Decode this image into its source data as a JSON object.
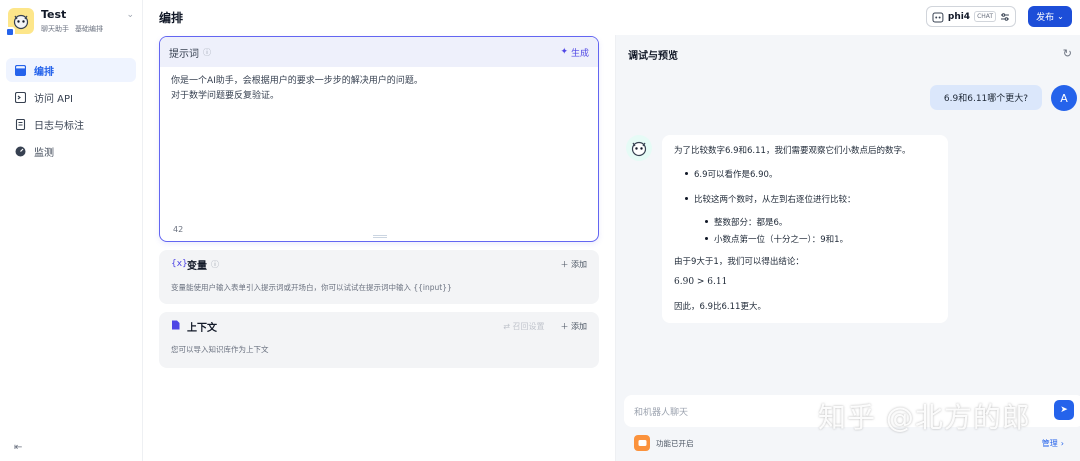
{
  "app": {
    "name": "Test",
    "tags": [
      "聊天助手",
      "基础编排"
    ]
  },
  "sidebar": {
    "items": [
      {
        "label": "编排",
        "icon": "layout-icon",
        "active": true
      },
      {
        "label": "访问 API",
        "icon": "terminal-icon",
        "active": false
      },
      {
        "label": "日志与标注",
        "icon": "document-icon",
        "active": false
      },
      {
        "label": "监测",
        "icon": "gauge-icon",
        "active": false
      }
    ]
  },
  "header": {
    "title": "编排",
    "model": {
      "name": "phi4",
      "mode": "CHAT"
    },
    "publish_label": "发布"
  },
  "prompt": {
    "title": "提示词",
    "generate_label": "生成",
    "lines": [
      "你是一个AI助手，会根据用户的要求一步步的解决用户的问题。",
      "对于数学问题要反复验证。"
    ],
    "count": "42"
  },
  "variables": {
    "title": "变量",
    "add_label": "添加",
    "description": "变量能使用户输入表单引入提示词或开场白，你可以试试在提示词中输入 {{input}}"
  },
  "context": {
    "title": "上下文",
    "recall_label": "召回设置",
    "add_label": "添加",
    "description": "您可以导入知识库作为上下文"
  },
  "debug": {
    "title": "调试与预览",
    "user_message": "6.9和6.11哪个更大?",
    "user_avatar": "A",
    "bot_reply": {
      "intro": "为了比较数字6.9和6.11，我们需要观察它们小数点后的数字。",
      "b1": "6.9可以看作是6.90。",
      "b2": "比较这两个数时，从左到右逐位进行比较：",
      "b2a": "整数部分：都是6。",
      "b2b": "小数点第一位（十分之一）：9和1。",
      "conclusion": "由于9大于1，我们可以得出结论：",
      "math": "6.90 > 6.11",
      "final": "因此，6.9比6.11更大。"
    },
    "input_placeholder": "和机器人聊天",
    "feature_status": "功能已开启",
    "manage_label": "管理"
  },
  "watermark": "知乎 @北方的郎",
  "colors": {
    "accent": "#2563eb",
    "prompt_border": "#6366f1",
    "panel_bg": "#f4f6f9"
  }
}
